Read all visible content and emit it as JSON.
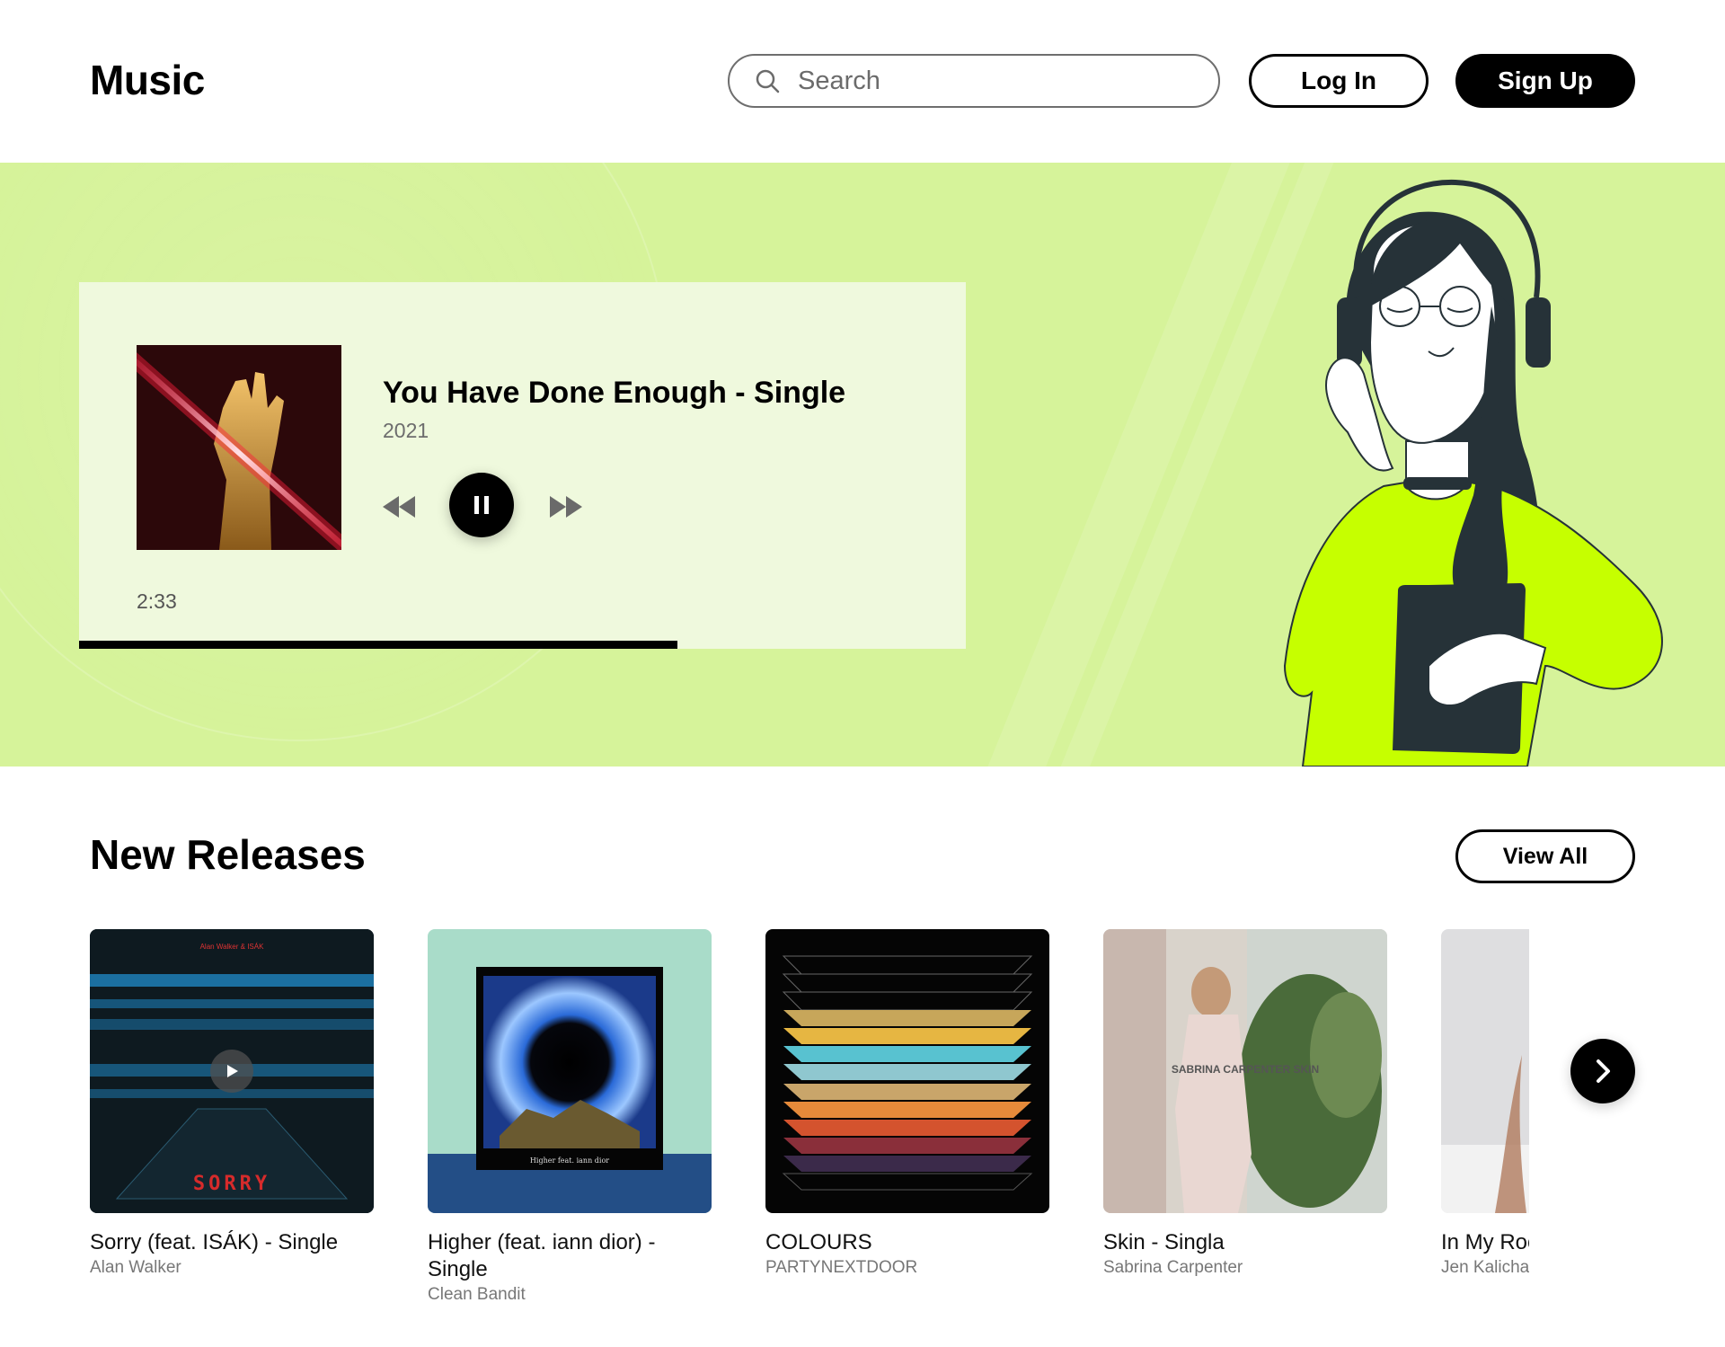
{
  "header": {
    "logo": "Music",
    "search_placeholder": "Search",
    "login_label": "Log In",
    "signup_label": "Sign Up"
  },
  "now_playing": {
    "title": "You Have Done Enough - Single",
    "year": "2021",
    "elapsed": "2:33",
    "progress": 0.675,
    "state": "playing"
  },
  "new_releases": {
    "title": "New Releases",
    "view_all_label": "View All",
    "items": [
      {
        "name": "Sorry (feat. ISÁK) - Single",
        "artist": "Alan Walker",
        "cover_top_text": "Alan Walker & ISÁK",
        "cover_text": "SORRY"
      },
      {
        "name": "Higher (feat. iann dior) - Single",
        "artist": "Clean Bandit",
        "cover_text": "Higher feat. iann dior"
      },
      {
        "name": "COLOURS",
        "artist": "PARTYNEXTDOOR"
      },
      {
        "name": "Skin - Singla",
        "artist": "Sabrina Carpenter",
        "cover_text": "SABRINA CARPENTER SKIN"
      },
      {
        "name": "In My Roo",
        "artist": "Jen Kalicha"
      }
    ]
  },
  "colors": {
    "hero_bg": "#d6f39a",
    "player_bg": "#eff9dd",
    "accent_lime": "#c6ff00",
    "text_primary": "#000000",
    "text_muted": "#777777"
  }
}
